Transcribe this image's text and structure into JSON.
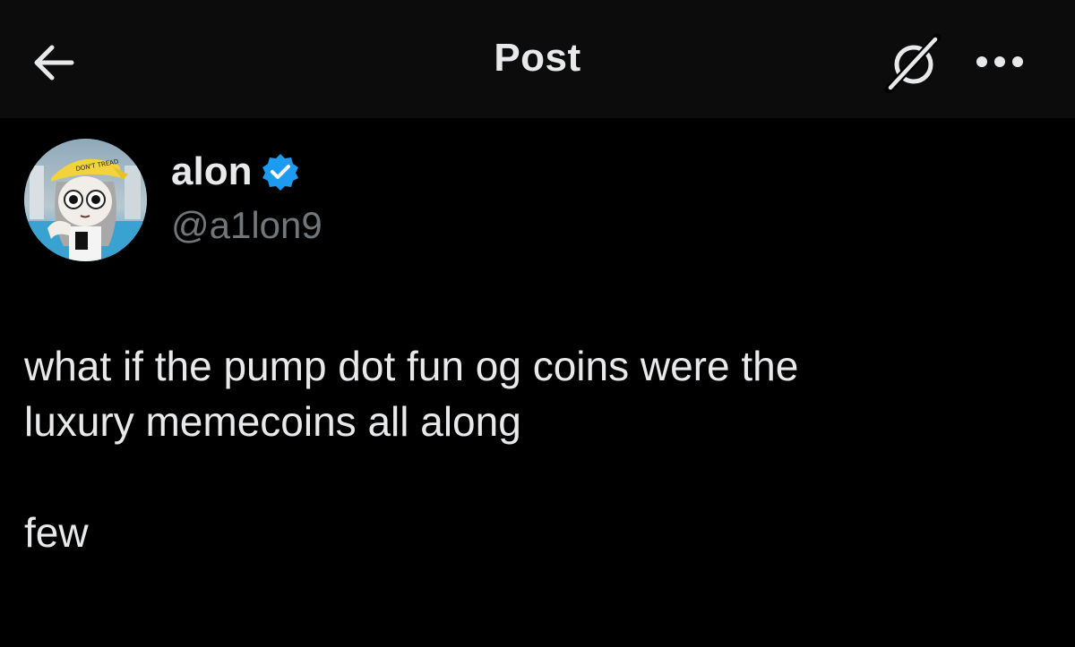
{
  "header": {
    "title": "Post",
    "back_icon": "arrow-left-icon",
    "grok_icon": "grok-icon",
    "more_icon": "more-horizontal-icon"
  },
  "author": {
    "display_name": "alon",
    "handle": "@a1lon9",
    "verified": true,
    "verified_color": "#1d9bf0"
  },
  "post": {
    "text": "what if the pump dot fun og coins were the\nluxury memecoins all along\n\nfew"
  },
  "colors": {
    "background": "#000000",
    "topbar": "#0c0c0c",
    "primary_text": "#e7e9ea",
    "secondary_text": "#71767b"
  }
}
